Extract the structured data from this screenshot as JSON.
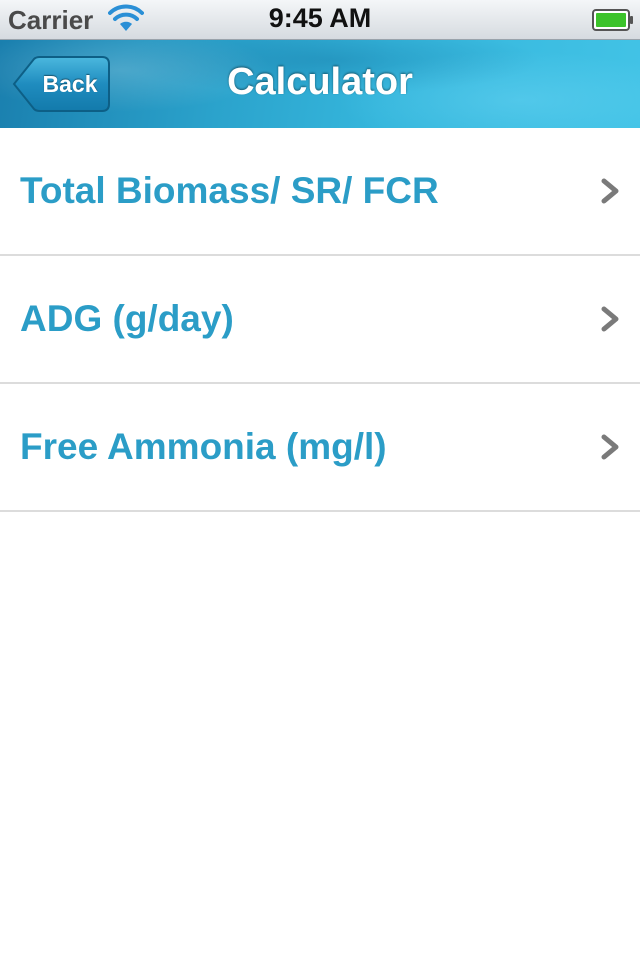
{
  "status_bar": {
    "carrier": "Carrier",
    "time": "9:45 AM",
    "icons": [
      "wifi-icon",
      "battery-icon"
    ]
  },
  "nav_bar": {
    "back_label": "Back",
    "title": "Calculator"
  },
  "list": {
    "items": [
      {
        "label": "Total Biomass/ SR/ FCR",
        "icon": "chevron-right-icon"
      },
      {
        "label": "ADG (g/day)",
        "icon": "chevron-right-icon"
      },
      {
        "label": "Free Ammonia (mg/l)",
        "icon": "chevron-right-icon"
      }
    ]
  },
  "colors": {
    "accent": "#2b9dc7",
    "nav_bar": "#2ba3cc",
    "battery": "#3cc32a",
    "chevron": "#7a7a7a",
    "separator": "#dcdcdc"
  }
}
